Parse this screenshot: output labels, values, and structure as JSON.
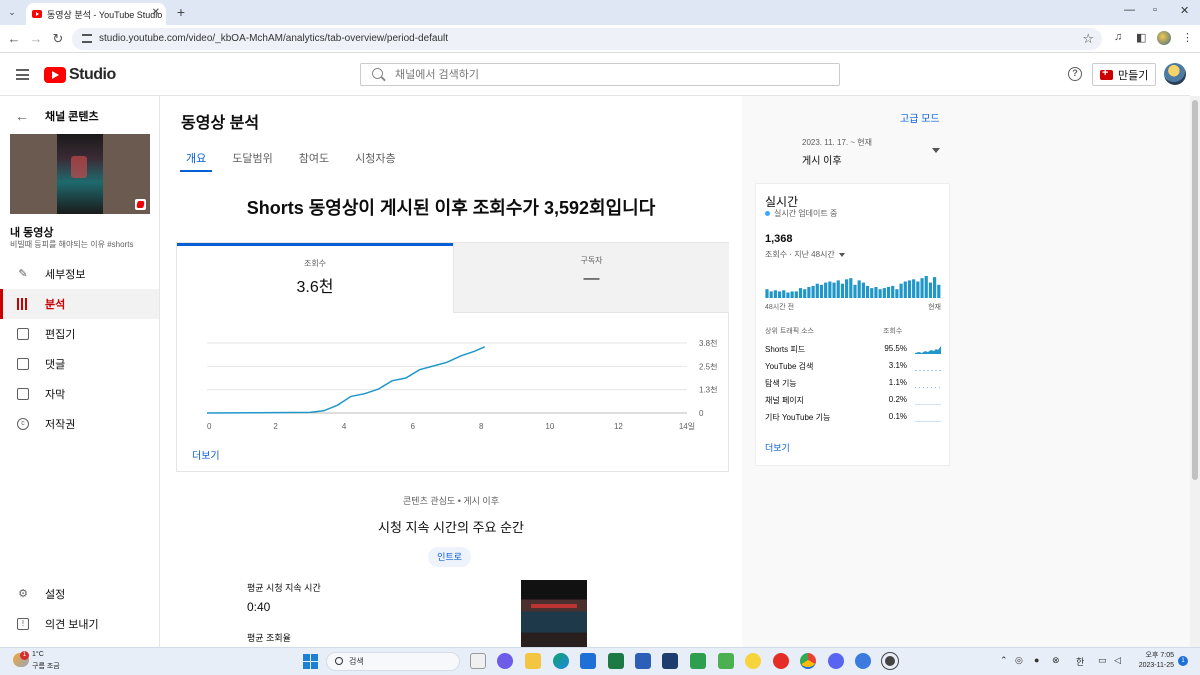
{
  "browser": {
    "tab_title": "동영상 분석 - YouTube Studio",
    "url": "studio.youtube.com/video/_kbOA-MchAM/analytics/tab-overview/period-default"
  },
  "header": {
    "logo": "Studio",
    "search_placeholder": "채널에서 검색하기",
    "create_label": "만들기"
  },
  "sidebar": {
    "channel_content": "채널 콘텐츠",
    "my_video": "내 동영상",
    "video_title": "비빌때 등피를 해야되는 이유 #shorts",
    "items": [
      {
        "label": "세부정보",
        "icon": "pencil-icon"
      },
      {
        "label": "분석",
        "icon": "analytics-icon"
      },
      {
        "label": "편집기",
        "icon": "editor-icon"
      },
      {
        "label": "댓글",
        "icon": "comments-icon"
      },
      {
        "label": "자막",
        "icon": "subtitles-icon"
      },
      {
        "label": "저작권",
        "icon": "copyright-icon"
      }
    ],
    "settings": "설정",
    "feedback": "의견 보내기"
  },
  "main": {
    "title": "동영상 분석",
    "tabs": [
      "개요",
      "도달범위",
      "참여도",
      "시청자층"
    ],
    "headline": "Shorts 동영상이 게시된 이후 조회수가 3,592회입니다",
    "metrics": [
      {
        "label": "조회수",
        "value": "3.6천"
      },
      {
        "label": "구독자",
        "value": "—"
      }
    ],
    "more": "더보기",
    "interest_caption": "콘텐츠 관심도 • 게시 이후",
    "moments_title": "시청 지속 시간의 주요 순간",
    "intro_chip": "인트로",
    "avg_duration_label": "평균 시청 지속 시간",
    "avg_duration_value": "0:40",
    "avg_percent_label": "평균 조회율"
  },
  "chart_data": {
    "type": "line",
    "x_ticks": [
      "0",
      "2",
      "4",
      "6",
      "8",
      "10",
      "12",
      "14일"
    ],
    "y_ticks": [
      "0",
      "1.3천",
      "2.5천",
      "3.8천"
    ],
    "ylim": [
      0,
      3800
    ],
    "xlim": [
      0,
      14
    ],
    "series": [
      {
        "x": [
          0,
          3.0,
          3.4,
          3.8,
          4.2,
          4.6,
          5.0,
          5.4,
          5.8,
          6.2,
          6.6,
          7.0,
          7.4,
          7.8,
          8.1
        ],
        "y": [
          0,
          30,
          120,
          420,
          900,
          1050,
          1300,
          1750,
          1900,
          2350,
          2550,
          2750,
          3100,
          3350,
          3592
        ]
      }
    ]
  },
  "right": {
    "advanced_mode": "고급 모드",
    "period_range": "2023. 11. 17. ~ 현재",
    "period_value": "게시 이후",
    "realtime": {
      "title": "실시간",
      "live": "실시간 업데이트 중",
      "views": "1,368",
      "views_sub": "조회수 · 지난 48시간",
      "axis_left": "48시간 전",
      "axis_right": "현재",
      "bars": [
        8,
        6,
        7,
        6,
        7,
        5,
        6,
        6,
        9,
        8,
        10,
        11,
        13,
        12,
        14,
        15,
        14,
        16,
        13,
        17,
        18,
        12,
        16,
        14,
        11,
        9,
        10,
        8,
        9,
        10,
        11,
        8,
        13,
        15,
        16,
        17,
        15,
        18,
        20,
        14,
        19,
        12
      ],
      "sources_header": "상위 트래픽 소스",
      "sources_col": "조회수",
      "sources": [
        {
          "name": "Shorts 피드",
          "pct": "95.5%"
        },
        {
          "name": "YouTube 검색",
          "pct": "3.1%"
        },
        {
          "name": "탐색 기능",
          "pct": "1.1%"
        },
        {
          "name": "채널 페이지",
          "pct": "0.2%"
        },
        {
          "name": "기타 YouTube 기능",
          "pct": "0.1%"
        }
      ],
      "more": "더보기"
    }
  },
  "taskbar": {
    "temp": "1°C",
    "weather": "구름 조금",
    "weather_badge": "1",
    "search": "검색",
    "lang": "한",
    "time": "오후 7:05",
    "date": "2023-11-25",
    "notif": "1"
  },
  "colors": {
    "accent": "#065fd4",
    "brand": "#ff0000",
    "line": "#2196c9"
  }
}
